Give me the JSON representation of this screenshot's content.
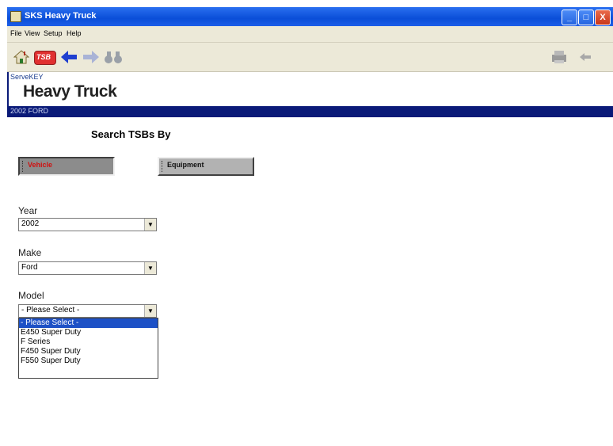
{
  "window": {
    "title": "SKS Heavy Truck",
    "controls": [
      "_",
      "□",
      "X"
    ]
  },
  "menu": [
    "File",
    "View",
    "Setup",
    "Help"
  ],
  "toolbar": {
    "left_icons": [
      "home-icon",
      "tsb-icon",
      "back-arrow-icon",
      "forward-arrow-icon",
      "binoculars-icon"
    ],
    "tsb_label": "TSB",
    "right_icons": [
      "printer-icon",
      "exit-icon"
    ]
  },
  "brand": {
    "small": "ServeKEY",
    "title": "Heavy Truck"
  },
  "vehicle_bar": "2002 FORD",
  "search": {
    "title": "Search TSBs By",
    "vehicle_button": "Vehicle",
    "equipment_button": "Equipment"
  },
  "fields": {
    "year": {
      "label": "Year",
      "value": "2002"
    },
    "make": {
      "label": "Make",
      "value": "Ford"
    },
    "model": {
      "label": "Model",
      "value": "- Please Select -"
    }
  },
  "model_options": [
    "- Please Select -",
    "E450 Super Duty",
    "F Series",
    "F450 Super Duty",
    "F550 Super Duty"
  ],
  "selected_option_index": 0,
  "colors": {
    "title_bar": "#0a4ed8",
    "vehicle_bar": "#0a1a78",
    "active_label": "#d01010",
    "selection": "#1d51c6"
  }
}
